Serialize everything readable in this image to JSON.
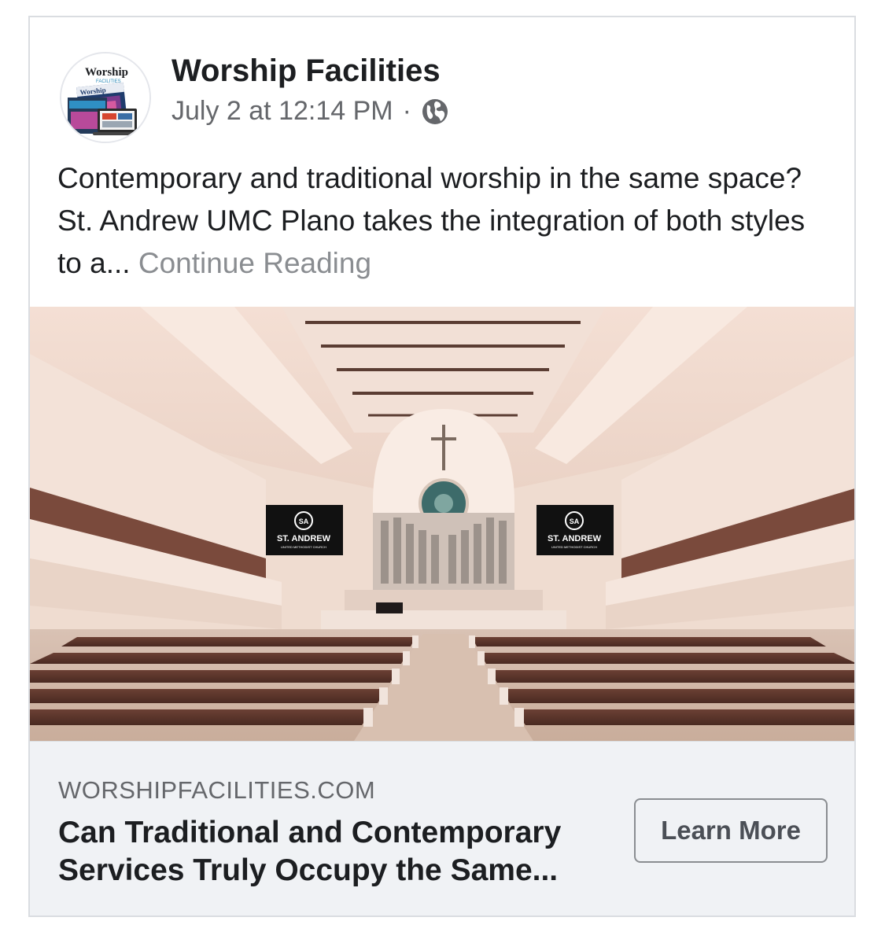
{
  "post": {
    "page_name": "Worship Facilities",
    "timestamp": "July 2 at 12:14 PM",
    "separator": "·",
    "privacy_icon": "globe-icon",
    "avatar": {
      "logo_text": "Worship",
      "logo_subtext": "FACILITIES",
      "magazine_text": "Worship"
    },
    "text": "Contemporary and traditional worship in the same space? St. Andrew UMC Plano takes the integration of both styles to a...",
    "continue_label": "Continue Reading"
  },
  "photo": {
    "screen_title": "ST. ANDREW",
    "screen_subtitle": "UNITED METHODIST CHURCH",
    "screen_logo": "SA"
  },
  "link_preview": {
    "domain": "WORSHIPFACILITIES.COM",
    "title": "Can Traditional and Contemporary Services Truly Occupy the Same...",
    "cta_label": "Learn More"
  },
  "colors": {
    "text_primary": "#1c1e21",
    "text_secondary": "#65676b",
    "preview_background": "#f0f2f5",
    "border": "#dadde1"
  }
}
